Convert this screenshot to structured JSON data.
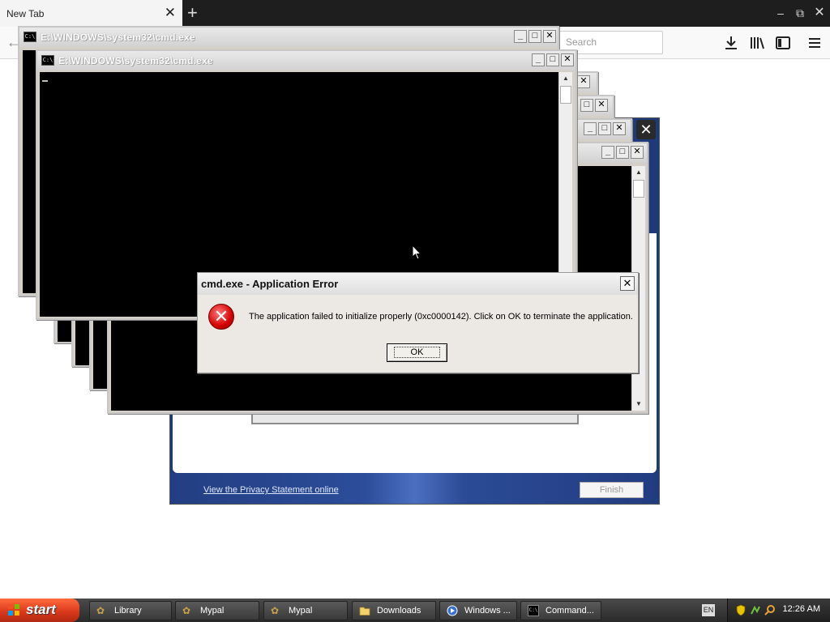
{
  "browser": {
    "tab_title": "New Tab",
    "search_placeholder": "Search"
  },
  "cmd_windows": {
    "title": "E:\\WINDOWS\\system32\\cmd.exe",
    "icon_text": "C:\\"
  },
  "wizard": {
    "privacy_link": "View the Privacy Statement online",
    "finish_label": "Finish"
  },
  "error_dialog": {
    "title": "cmd.exe - Application Error",
    "message": "The application failed to initialize properly (0xc0000142). Click on OK to terminate the application.",
    "ok_label": "OK",
    "icon": "error-x-icon"
  },
  "taskbar": {
    "start_label": "start",
    "tasks": [
      {
        "label": "Library",
        "icon": "library-icon"
      },
      {
        "label": "Mypal",
        "icon": "mypal-icon"
      },
      {
        "label": "Mypal",
        "icon": "mypal-icon"
      },
      {
        "label": "Downloads",
        "icon": "folder-icon"
      },
      {
        "label": "Windows ...",
        "icon": "windows-media-icon"
      },
      {
        "label": "Command...",
        "icon": "cmd-icon"
      }
    ],
    "language": "EN",
    "clock": "12:26 AM"
  },
  "colors": {
    "title_bar_inactive": "#d6d6d6",
    "error_red": "#d40000",
    "wizard_blue": "#1f3a7a",
    "start_orange": "#d8361a"
  }
}
